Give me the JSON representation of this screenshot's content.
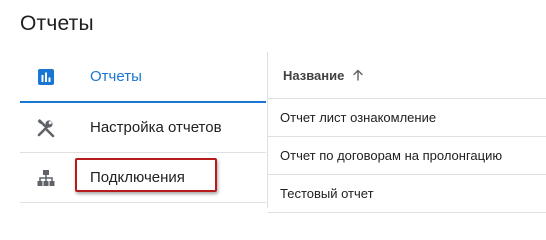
{
  "page": {
    "title": "Отчеты"
  },
  "sidebar": {
    "items": [
      {
        "label": "Отчеты",
        "icon": "bar-chart-icon",
        "active": true
      },
      {
        "label": "Настройка отчетов",
        "icon": "tools-icon",
        "active": false
      },
      {
        "label": "Подключения",
        "icon": "sitemap-icon",
        "active": false
      }
    ]
  },
  "table": {
    "columns": [
      {
        "label": "Название",
        "sort": "ascending",
        "sort_icon": "arrow-up-icon"
      }
    ],
    "rows": [
      {
        "name": "Отчет лист ознакомление"
      },
      {
        "name": "Отчет по договорам на пролонгацию"
      },
      {
        "name": "Тестовый отчет"
      }
    ]
  },
  "colors": {
    "accent": "#1976d2",
    "highlight": "#b71c1c",
    "icon": "#5f6368",
    "divider": "#e0e0e0"
  }
}
